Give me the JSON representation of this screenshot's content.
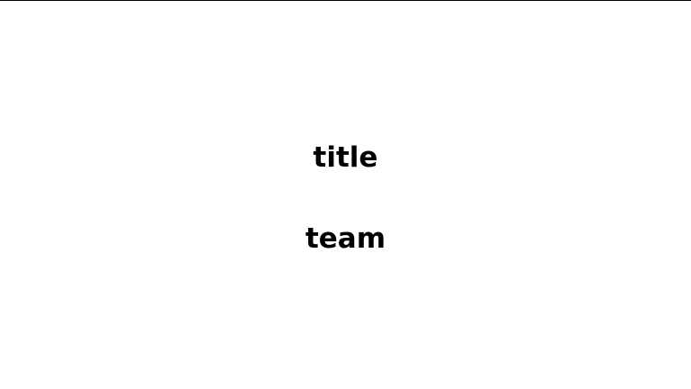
{
  "slide": {
    "title": "title",
    "subtitle": "team"
  },
  "colors": {
    "background": "#ffffff",
    "text": "#000000",
    "border": "#000000"
  }
}
